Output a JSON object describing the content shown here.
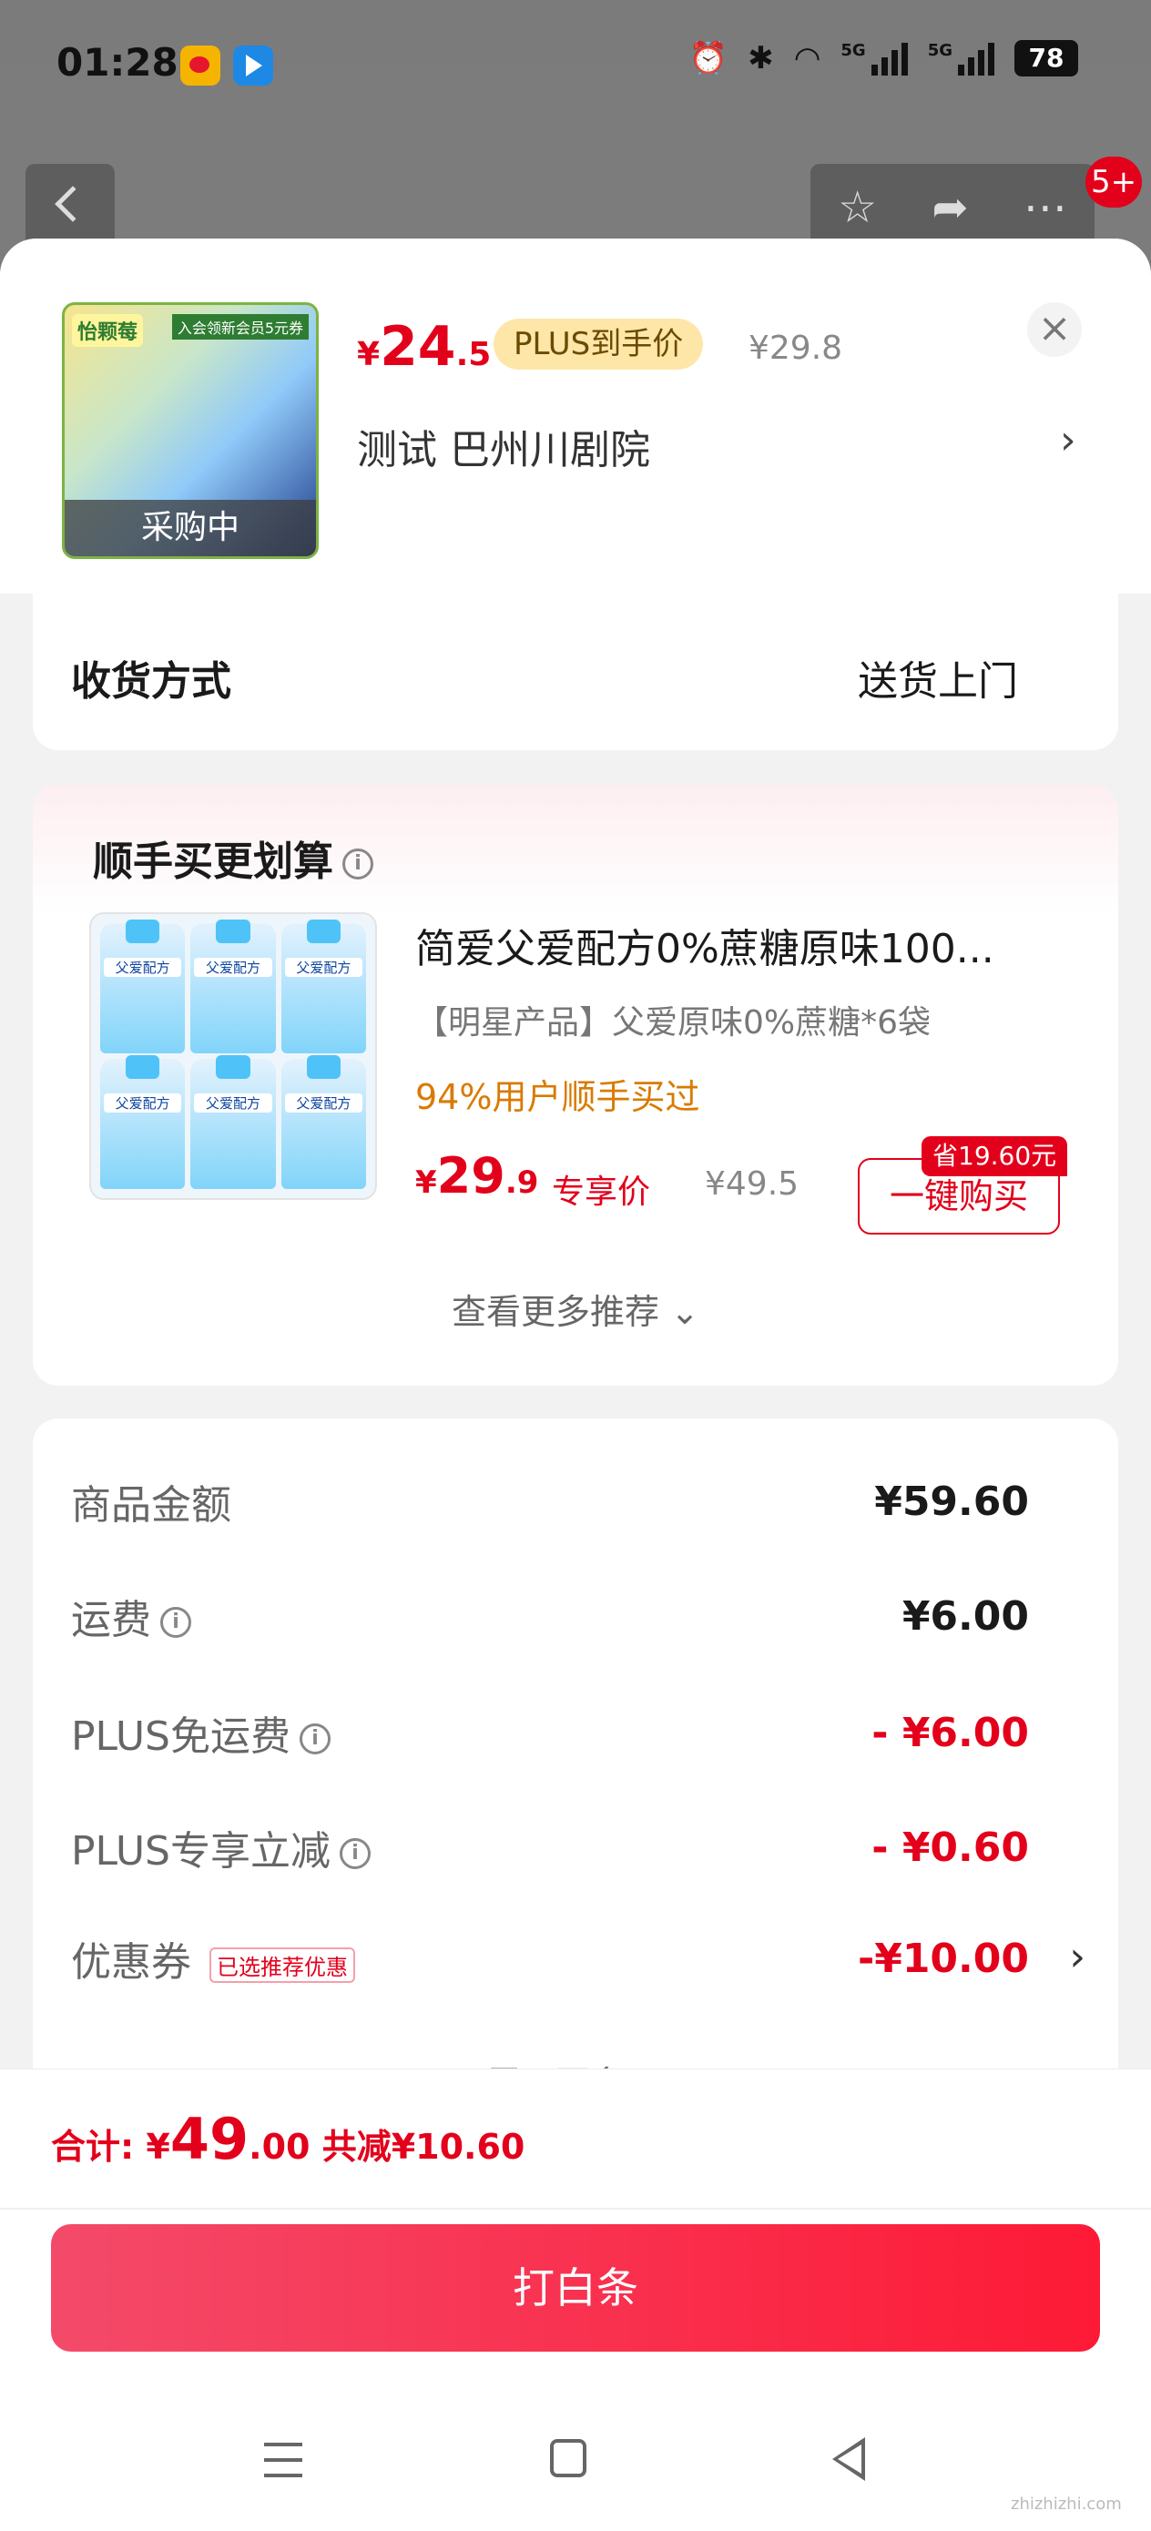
{
  "status_bar": {
    "time": "01:28",
    "network1": "5G",
    "network2": "5G",
    "battery": "78"
  },
  "nav": {
    "notif_count": "5+"
  },
  "product": {
    "thumb_brand": "怡颗莓",
    "thumb_tag": "入会领新会员5元券",
    "thumb_status": "采购中",
    "price_currency": "¥",
    "price_int": "24",
    "price_dec": ".5",
    "plus_tag": "PLUS到手价",
    "price_orig": "¥29.8",
    "store": "测试  巴州川剧院"
  },
  "delivery": {
    "label": "收货方式",
    "value": "送货上门"
  },
  "recommend": {
    "title": "顺手买更划算",
    "name": "简爱父爱配方0%蔗糖原味100...",
    "sub": "【明星产品】父爱原味0%蔗糖*6袋",
    "stat": "94%用户顺手买过",
    "price_currency": "¥",
    "price_int": "29",
    "price_dec": ".9",
    "price_label": "专享价",
    "price_orig": "¥49.5",
    "save_tag": "省19.60元",
    "buy_label": "一键购买",
    "more": "查看更多推荐 ⌄"
  },
  "summary": {
    "goods_label": "商品金额",
    "goods_value": "¥59.60",
    "ship_label": "运费",
    "ship_value": "¥6.00",
    "plus_ship_label": "PLUS免运费",
    "plus_ship_value": "- ¥6.00",
    "plus_cut_label": "PLUS专享立减",
    "plus_cut_value": "- ¥0.60",
    "coupon_label": "优惠券",
    "coupon_tag": "已选推荐优惠",
    "coupon_value": "-¥10.00",
    "expand": "展开更多 ⌄"
  },
  "footer": {
    "total_prefix": "合计: ¥",
    "total_int": "49",
    "total_dec": ".00",
    "total_saved": " 共减¥10.60",
    "pay_label": "打白条"
  },
  "watermark": "zhizhizhi.com"
}
